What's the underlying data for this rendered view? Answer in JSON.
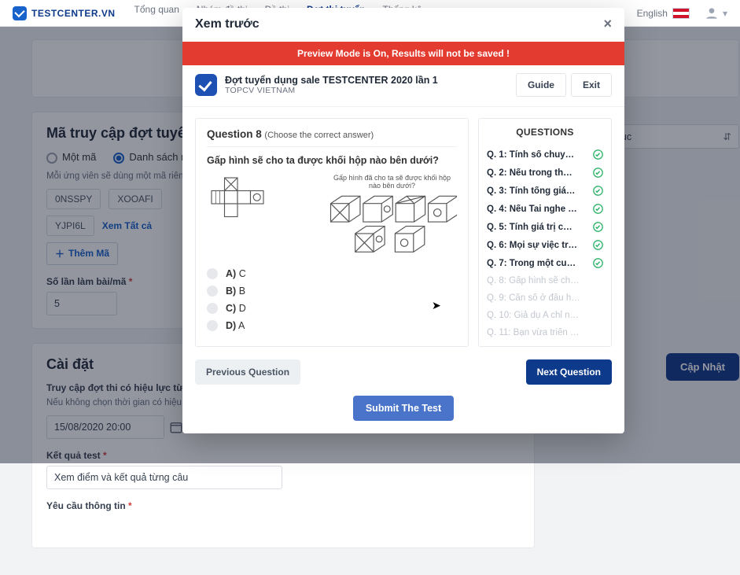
{
  "brand": "TESTCENTER.VN",
  "nav": {
    "items": [
      "Tổng quan",
      "Nhóm đề thi",
      "Đề thi",
      "Đợt thi tuyển",
      "Thống kê"
    ],
    "active_index": 3,
    "lang_label": "English",
    "account_icon": "user-icon"
  },
  "background": {
    "section1_title": "Mã truy cập đợt tuyển dụng",
    "mode_single": "Một mã",
    "mode_list": "Danh sách mã",
    "mode_selected": "list",
    "hint": "Mỗi ứng viên sẽ dùng một mã riêng để truy cập vào link thi tuyển",
    "codes": [
      "0NSSPY",
      "XOOAFI",
      "YJPI6L"
    ],
    "view_all": "Xem Tất cả",
    "add_code": "Thêm Mã",
    "attempts_label": "Số lần làm bài/mã",
    "attempts_value": "5",
    "section2_title": "Cài đặt",
    "access_label": "Truy cập đợt thi có hiệu lực từ",
    "access_hint": "Nếu không chọn thời gian có hiệu lực thì đợt tuyển dụng sẽ có hiệu lực không giới hạn",
    "date_value": "15/08/2020 20:00",
    "result_label": "Kết quả test",
    "result_value": "Xem điểm và kết quả từng câu",
    "require_label": "Yêu cầu thông tin",
    "category_placeholder": "Tất cả danh mục",
    "update_btn": "Cập Nhật"
  },
  "modal": {
    "title": "Xem trước",
    "banner": "Preview Mode is On, Results will not be saved !",
    "exam_title": "Đợt tuyển dụng sale TESTCENTER 2020 lần 1",
    "exam_org": "TOPCV VIETNAM",
    "guide": "Guide",
    "exit": "Exit",
    "q_number_prefix": "Question ",
    "q_number": "8",
    "q_instruction": "(Choose the correct answer)",
    "q_prompt": "Gấp hình sẽ cho ta được khối hộp nào bên dưới?",
    "img_caption": "Gấp hình đã cho ta sẽ được khối hộp nào bên dưới?",
    "options": [
      {
        "key": "A)",
        "val": "C"
      },
      {
        "key": "B)",
        "val": "B"
      },
      {
        "key": "C)",
        "val": "D"
      },
      {
        "key": "D)",
        "val": "A"
      }
    ],
    "side_title": "QUESTIONS",
    "questions": [
      {
        "label": "Q. 1: Tính số chuy…",
        "done": true
      },
      {
        "label": "Q. 2: Nếu trong th…",
        "done": true
      },
      {
        "label": "Q. 3: Tính tổng giá…",
        "done": true
      },
      {
        "label": "Q. 4: Nếu Tai nghe …",
        "done": true
      },
      {
        "label": "Q. 5: Tính giá trị c…",
        "done": true
      },
      {
        "label": "Q. 6: Mọi sự việc tr…",
        "done": true
      },
      {
        "label": "Q. 7: Trong một cu…",
        "done": true
      },
      {
        "label": "Q. 8: Gấp hình sẽ ch…",
        "done": false
      },
      {
        "label": "Q. 9: Cần số ở đầu h…",
        "done": false
      },
      {
        "label": "Q. 10: Giả dụ A chỉ n…",
        "done": false
      },
      {
        "label": "Q. 11: Bạn vừa triển …",
        "done": false
      }
    ],
    "prev": "Previous Question",
    "next": "Next Question",
    "submit": "Submit The Test"
  },
  "colors": {
    "primary": "#0d3a8a",
    "danger": "#e33b2f",
    "ok": "#2fb36a"
  }
}
